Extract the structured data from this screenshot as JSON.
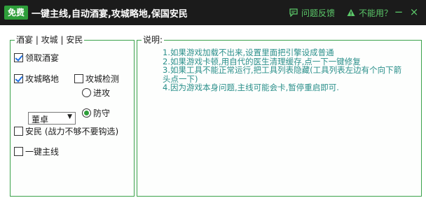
{
  "titlebar": {
    "badge": "免费",
    "title": "一键主线,自动酒宴,攻城略地,保国安民",
    "feedback": "问题反馈",
    "cant_use": "不能用？",
    "minimize": "−",
    "close": "×"
  },
  "left_panel": {
    "label": "酒宴 | 攻城 | 安民",
    "banquet": {
      "label": "领取酒宴",
      "checked": true
    },
    "siege": {
      "label": "攻城略地",
      "checked": true
    },
    "siege_check": {
      "label": "攻城检测",
      "checked": false
    },
    "attack": {
      "label": "进攻",
      "selected": false
    },
    "defend": {
      "label": "防守",
      "selected": true
    },
    "general_select": {
      "value": "董卓"
    },
    "pacify": {
      "label": "安民 (战力不够不要钩选)",
      "checked": false
    },
    "mainline": {
      "label": "一键主线",
      "checked": false
    }
  },
  "right_panel": {
    "label": "说明:",
    "notes": [
      "1.如果游戏加载不出来,设置里面把引擎设成普通",
      "2.如果游戏卡顿,用自代的医生清理缓存,点一下一键修复",
      "3.如果工具不能正常运行,把工具列表隐藏(工具列表左边有个向下箭",
      "头点一下)",
      "4.因为游戏本身问题,主线可能会卡,暂停重启即可."
    ]
  },
  "colors": {
    "titlebar_bg": "#1b1b1b",
    "accent_green": "#2e9e3a",
    "note_text": "#2a8f8a"
  }
}
